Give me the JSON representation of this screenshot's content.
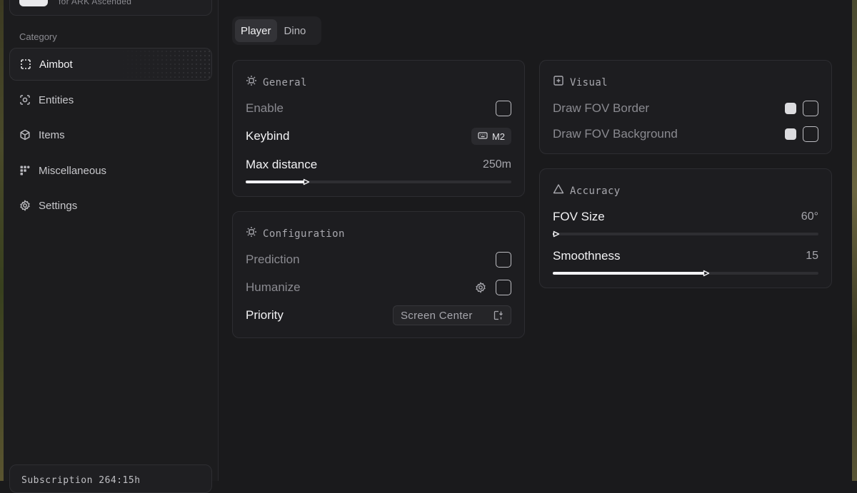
{
  "brand": {
    "subtitle": "for ARK Ascended"
  },
  "sidebar": {
    "category_label": "Category",
    "items": [
      {
        "label": "Aimbot",
        "icon": "dashed-square-icon",
        "active": true
      },
      {
        "label": "Entities",
        "icon": "scan-face-icon",
        "active": false
      },
      {
        "label": "Items",
        "icon": "cube-icon",
        "active": false
      },
      {
        "label": "Miscellaneous",
        "icon": "grid-icon",
        "active": false
      },
      {
        "label": "Settings",
        "icon": "gear-icon",
        "active": false
      }
    ],
    "subscription_text": "Subscription 264:15h"
  },
  "tabs": [
    {
      "label": "Player",
      "active": true
    },
    {
      "label": "Dino",
      "active": false
    }
  ],
  "general": {
    "title": "General",
    "enable_label": "Enable",
    "enable_checked": false,
    "keybind_label": "Keybind",
    "keybind_value": "M2",
    "max_distance_label": "Max distance",
    "max_distance_value": "250m",
    "max_distance_fraction": 0.22
  },
  "configuration": {
    "title": "Configuration",
    "prediction_label": "Prediction",
    "prediction_checked": false,
    "humanize_label": "Humanize",
    "humanize_checked": false,
    "priority_label": "Priority",
    "priority_value": "Screen Center"
  },
  "visual": {
    "title": "Visual",
    "fov_border_label": "Draw FOV Border",
    "fov_background_label": "Draw FOV Background"
  },
  "accuracy": {
    "title": "Accuracy",
    "fov_size_label": "FOV Size",
    "fov_size_value": "60°",
    "fov_size_fraction": 0.0,
    "smoothness_label": "Smoothness",
    "smoothness_value": "15",
    "smoothness_fraction": 0.58
  },
  "colors": {
    "background": "#1a1a1c",
    "card": "#1d1d20",
    "accent": "#f2f2f4",
    "muted_text": "#8a8a90"
  }
}
